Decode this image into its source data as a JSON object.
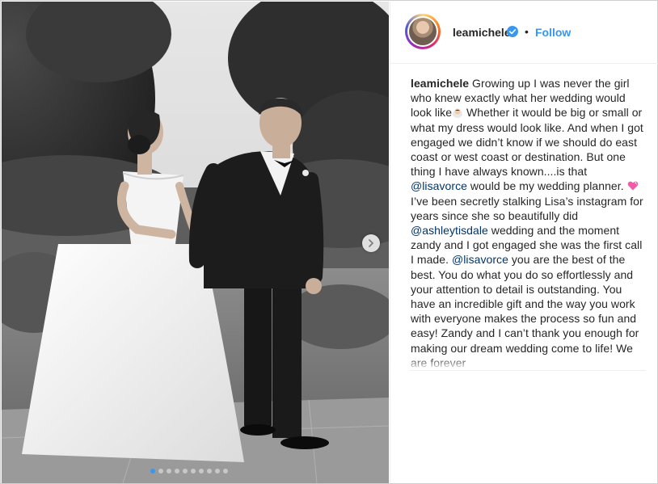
{
  "post": {
    "username": "leamichele",
    "bullet": "•",
    "follow_label": "Follow",
    "icons": {
      "verified": "verified-badge-icon",
      "next": "chevron-right-icon",
      "emoji_bride": "bride-emoji-icon",
      "emoji_heart": "pink-heart-emoji-icon"
    },
    "colors": {
      "accent": "#3897f0",
      "mention": "#003569",
      "text": "#262626"
    },
    "carousel": {
      "dot_count": 10,
      "active_index": 0
    }
  },
  "caption": {
    "username": "leamichele",
    "seg1": " Growing up I was never the girl who knew exactly what her wedding would look like",
    "seg2": " Whether it would be big or small or what my dress would look like. And when I got engaged we didn’t know if we should do east coast or west coast or destination. But one thing I have always known....is that ",
    "mention1": "@lisavorce",
    "seg3": " would be my wedding planner. ",
    "seg4": " I’ve been secretly stalking Lisa’s instagram for years since she so beautifully did ",
    "mention2": "@ashleytisdale",
    "seg5": " wedding and the moment zandy and I got engaged she was the first call I made. ",
    "mention3": "@lisavorce",
    "seg6": " you are the best of the best. You do what you do so effortlessly and your attention to detail is outstanding. You have an incredible gift and the way you work with everyone makes the process so fun and easy! Zandy and I can’t thank you enough for making our dream wedding come to life! We are forever"
  }
}
